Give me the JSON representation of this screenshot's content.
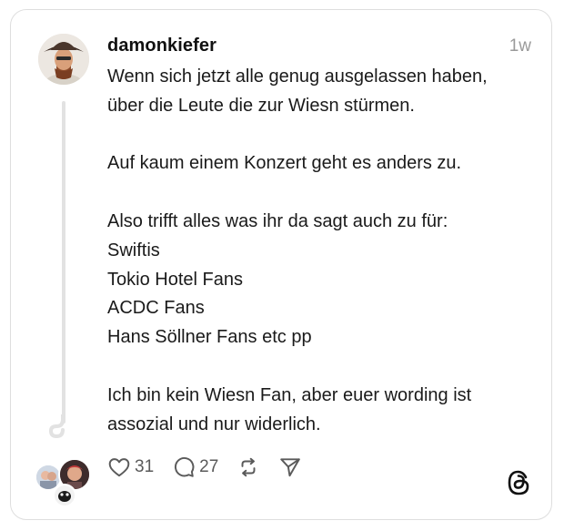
{
  "post": {
    "username": "damonkiefer",
    "time": "1w",
    "lines": [
      "Wenn sich jetzt alle genug ausgelassen haben,",
      "über die Leute die zur Wiesn stürmen.",
      "",
      "Auf kaum einem Konzert geht es anders zu.",
      "",
      "Also trifft alles was ihr da sagt auch zu für:",
      "Swiftis",
      "Tokio Hotel Fans",
      "ACDC Fans",
      "Hans Söllner Fans etc pp",
      "",
      "Ich bin kein Wiesn Fan, aber euer wording ist",
      "assozial und nur widerlich."
    ]
  },
  "actions": {
    "like_count": "31",
    "reply_count": "27",
    "like_icon": "heart-icon",
    "reply_icon": "comment-icon",
    "repost_icon": "repost-icon",
    "share_icon": "send-icon"
  },
  "colors": {
    "text": "#1a1a1a",
    "muted": "#9a9a9a",
    "border": "#dedede",
    "thread_line": "#e2e2e2"
  }
}
